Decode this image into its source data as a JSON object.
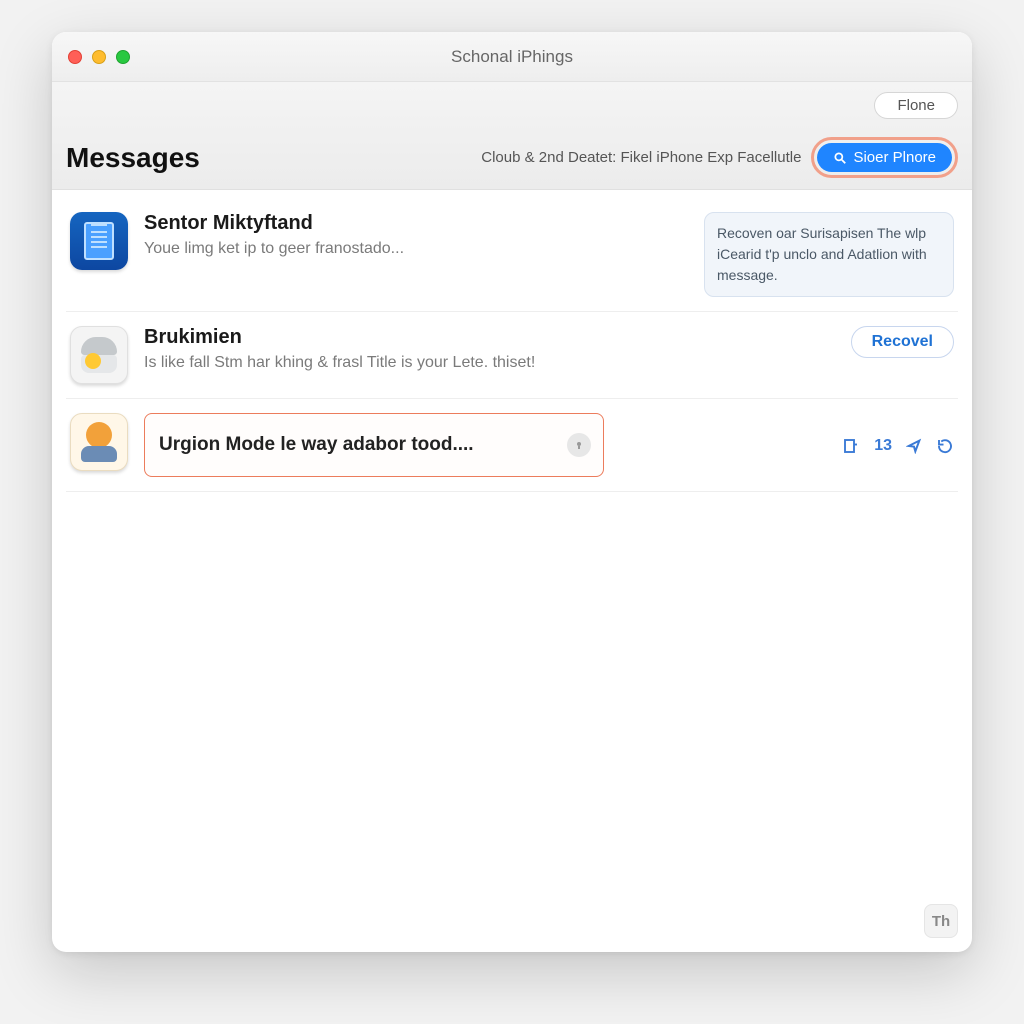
{
  "window": {
    "title": "Schonal iPhings"
  },
  "toolbar": {
    "top_button": "Flone",
    "heading": "Messages",
    "subtext": "Cloub & 2nd Deatet: Fikel iPhone Exp Facellutle",
    "search_label": "Sioer Plnore"
  },
  "items": [
    {
      "title": "Sentor Miktyftand",
      "subtitle": "Youe limg ket ip to geer franostado...",
      "note": "Recoven oar Surisapisen The wlp iCearid t'p unclo and Adatlion with message."
    },
    {
      "title": "Brukimien",
      "subtitle": "Is like fall Stm har khing & frasl Title is your Lete. thiset!",
      "action_label": "Recovel"
    },
    {
      "input_text": "Urgion Mode le way adabor tood....",
      "toolbar_count": "13"
    }
  ],
  "corner_label": "Th"
}
